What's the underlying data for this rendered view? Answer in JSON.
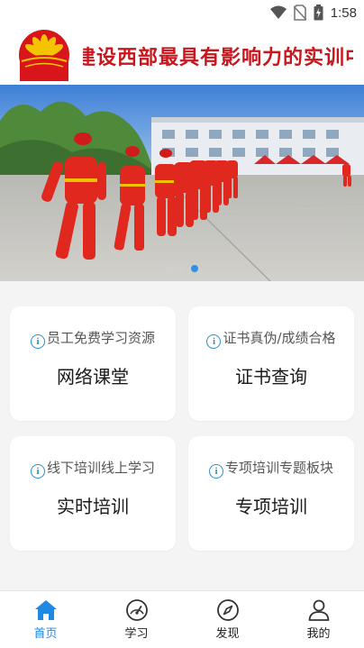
{
  "status_bar": {
    "time": "1:58",
    "icons": [
      "wifi-icon",
      "no-sim-icon",
      "battery-icon"
    ]
  },
  "header": {
    "logo": "cnpc-petal-logo",
    "marquee_text": "建设西部最具有影响力的实训中"
  },
  "banner": {
    "image": "workers-in-red-coveralls-photo",
    "slides": 3,
    "active_slide": 3
  },
  "cards": [
    {
      "subtitle": "员工免费学习资源",
      "title": "网络课堂",
      "icon": "info-icon"
    },
    {
      "subtitle": "证书真伪/成绩合格",
      "title": "证书查询",
      "icon": "info-icon"
    },
    {
      "subtitle": "线下培训线上学习",
      "title": "实时培训",
      "icon": "info-icon"
    },
    {
      "subtitle": "专项培训专题板块",
      "title": "专项培训",
      "icon": "info-icon"
    }
  ],
  "tabbar": {
    "items": [
      {
        "label": "首页",
        "icon": "home-icon",
        "active": true
      },
      {
        "label": "学习",
        "icon": "gauge-icon",
        "active": false
      },
      {
        "label": "发现",
        "icon": "compass-icon",
        "active": false
      },
      {
        "label": "我的",
        "icon": "user-icon",
        "active": false
      }
    ]
  },
  "colors": {
    "accent": "#1e88e5",
    "marquee": "#c8161d",
    "info_icon": "#2a8fd0",
    "background": "#f4f4f4"
  }
}
